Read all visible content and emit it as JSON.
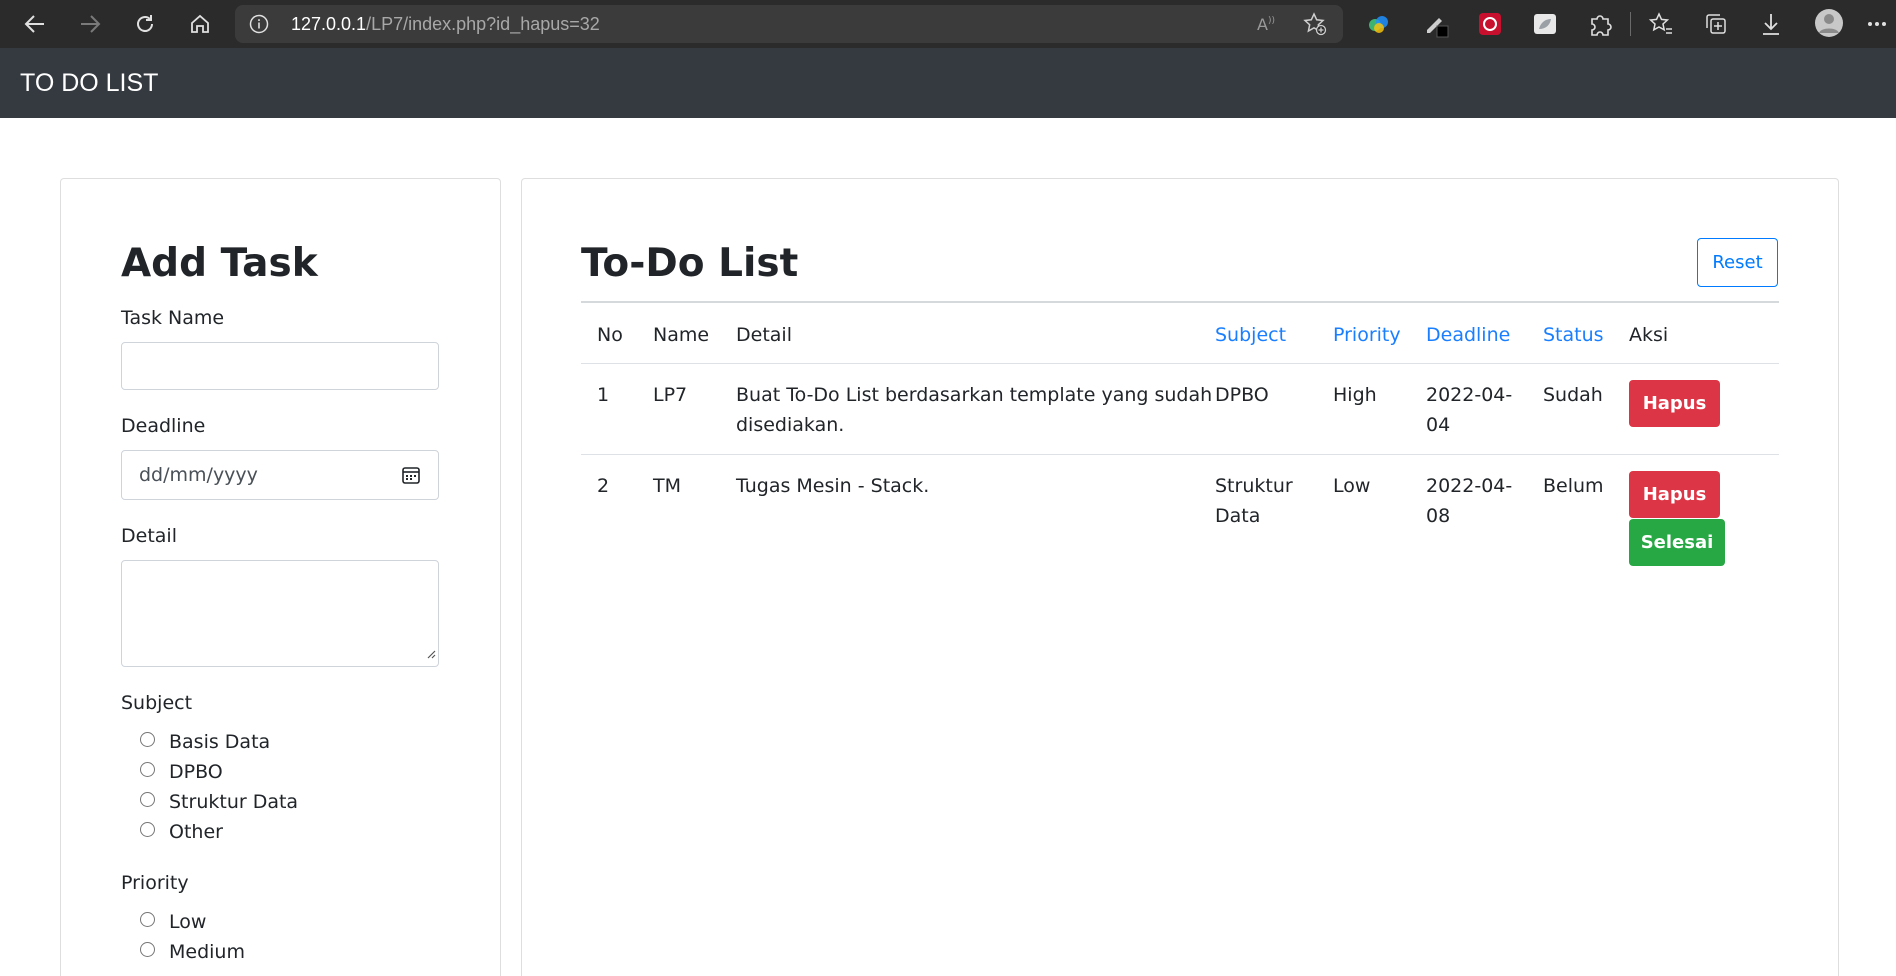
{
  "browser": {
    "url_host": "127.0.0.1",
    "url_path": "/LP7/index.php?id_hapus=32",
    "icons": [
      "back-icon",
      "forward-icon",
      "refresh-icon",
      "home-icon",
      "info-icon",
      "read-aloud-icon",
      "add-favorite-icon",
      "extension-icons",
      "puzzle-icon",
      "favorites-icon",
      "collections-icon",
      "downloads-icon",
      "profile-icon",
      "more-icon"
    ]
  },
  "navbar": {
    "brand": "TO DO LIST"
  },
  "add_task": {
    "title": "Add Task",
    "task_name_label": "Task Name",
    "deadline_label": "Deadline",
    "deadline_placeholder": "dd/mm/yyyy",
    "detail_label": "Detail",
    "subject_label": "Subject",
    "subject_options": [
      "Basis Data",
      "DPBO",
      "Struktur Data",
      "Other"
    ],
    "priority_label": "Priority",
    "priority_options": [
      "Low",
      "Medium"
    ]
  },
  "todo": {
    "title": "To-Do List",
    "reset_label": "Reset",
    "columns": [
      "No",
      "Name",
      "Detail",
      "Subject",
      "Priority",
      "Deadline",
      "Status",
      "Aksi"
    ],
    "rows": [
      {
        "no": "1",
        "name": "LP7",
        "detail_l1": "Buat To-Do List berdasarkan template yang sudah",
        "detail_l2": "disediakan.",
        "subject_l1": "DPBO",
        "subject_l2": "",
        "priority": "High",
        "deadline_l1": "2022-04-",
        "deadline_l2": "04",
        "status": "Sudah",
        "delete_label": "Hapus"
      },
      {
        "no": "2",
        "name": "TM",
        "detail_l1": "Tugas Mesin - Stack.",
        "detail_l2": "",
        "subject_l1": "Struktur",
        "subject_l2": "Data",
        "priority": "Low",
        "deadline_l1": "2022-04-",
        "deadline_l2": "08",
        "status": "Belum",
        "delete_label": "Hapus",
        "done_label": "Selesai"
      }
    ]
  },
  "colors": {
    "navbar": "#343a40",
    "primary": "#007bff",
    "danger": "#dc3545",
    "success": "#28a745"
  }
}
